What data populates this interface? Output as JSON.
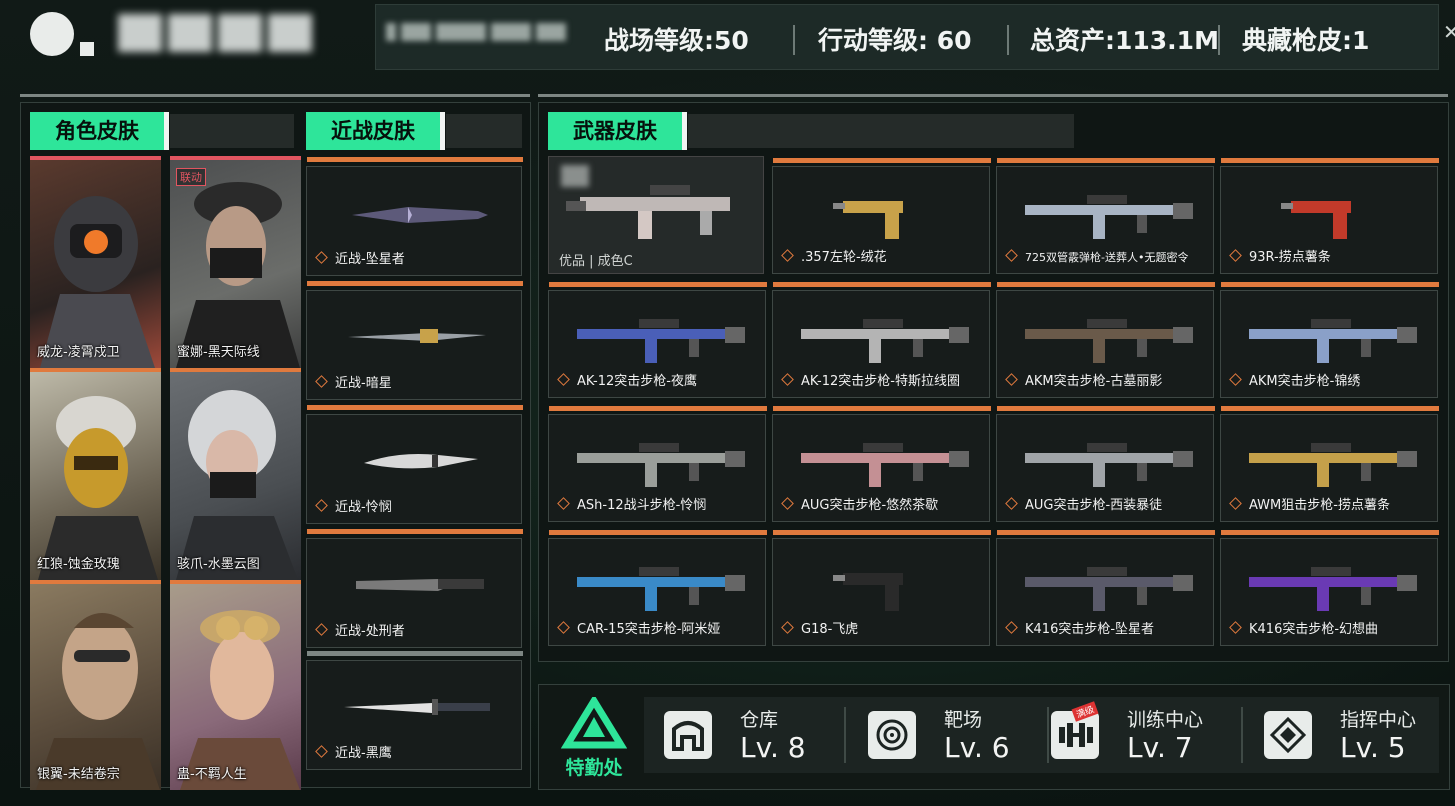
{
  "header": {
    "stats": [
      {
        "label": "战场等级:",
        "value": "50"
      },
      {
        "label": "行动等级: ",
        "value": "60"
      },
      {
        "label": "总资产:",
        "value": "113.1M"
      },
      {
        "label": "典藏枪皮:",
        "value": "1"
      }
    ]
  },
  "sections": {
    "character": "角色皮肤",
    "melee": "近战皮肤",
    "weapon": "武器皮肤"
  },
  "characters": [
    {
      "name": "威龙-凌霄戍卫"
    },
    {
      "name": "蜜娜-黑天际线",
      "tag": "联动"
    },
    {
      "name": "红狼-蚀金玫瑰"
    },
    {
      "name": "骇爪-水墨云图"
    },
    {
      "name": "银翼-未结卷宗"
    },
    {
      "name": "蛊-不羁人生"
    }
  ],
  "melee": [
    {
      "name": "近战-坠星者"
    },
    {
      "name": "近战-暗星"
    },
    {
      "name": "近战-怜悯"
    },
    {
      "name": "近战-处刑者"
    },
    {
      "name": "近战-黑鹰"
    }
  ],
  "featured_weapon": {
    "caption": "优品 | 成色C"
  },
  "weapons": [
    {
      "name": ".357左轮-绒花"
    },
    {
      "name": "725双管霰弹枪-送葬人•无题密令"
    },
    {
      "name": "93R-捞点薯条"
    },
    {
      "name": "AK-12突击步枪-夜鹰"
    },
    {
      "name": "AK-12突击步枪-特斯拉线圈"
    },
    {
      "name": "AKM突击步枪-古墓丽影"
    },
    {
      "name": "AKM突击步枪-锦绣"
    },
    {
      "name": "ASh-12战斗步枪-怜悯"
    },
    {
      "name": "AUG突击步枪-悠然茶歇"
    },
    {
      "name": "AUG突击步枪-西装暴徒"
    },
    {
      "name": "AWM狙击步枪-捞点薯条"
    },
    {
      "name": "CAR-15突击步枪-阿米娅"
    },
    {
      "name": "G18-飞虎"
    },
    {
      "name": "K416突击步枪-坠星者"
    },
    {
      "name": "K416突击步枪-幻想曲"
    }
  ],
  "facility": {
    "name": "特勤处",
    "items": [
      {
        "label": "仓库",
        "level": "Lv. 8",
        "icon": "warehouse-icon"
      },
      {
        "label": "靶场",
        "level": "Lv. 6",
        "icon": "target-icon"
      },
      {
        "label": "训练中心",
        "level": "Lv. 7",
        "icon": "dumbbell-icon",
        "badge": "满级"
      },
      {
        "label": "指挥中心",
        "level": "Lv. 5",
        "icon": "command-icon"
      }
    ]
  },
  "colors": {
    "accent": "#2ee59a",
    "rarity_orange": "#e07a3e",
    "rarity_red": "#e05560"
  }
}
